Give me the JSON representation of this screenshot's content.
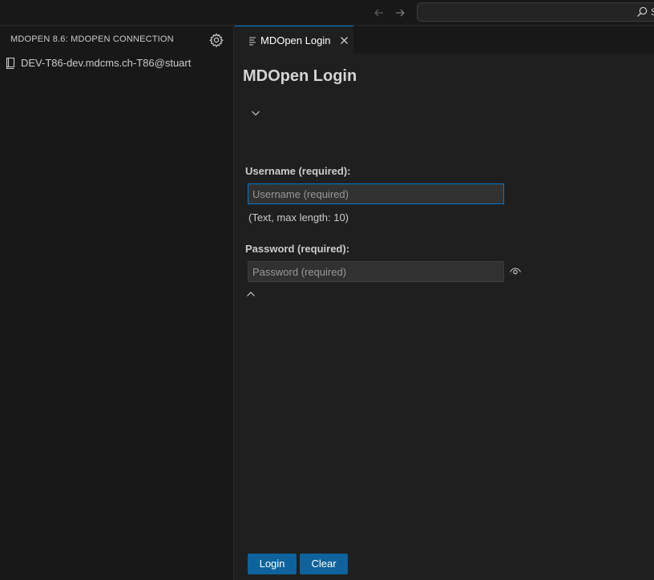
{
  "titlebar": {
    "back_icon": "arrow-left-icon",
    "forward_icon": "arrow-right-icon",
    "command_center": {
      "icon": "search-icon",
      "text": "S"
    }
  },
  "sidebar": {
    "title": "MDOPEN 8.6: MDOPEN CONNECTION",
    "settings_icon": "gear-icon",
    "items": [
      {
        "icon": "book-icon",
        "label": "DEV-T86-dev.mdcms.ch-T86@stuart"
      }
    ]
  },
  "tabs": [
    {
      "icon": "preview-icon",
      "label": "MDOpen Login",
      "close_icon": "close-icon",
      "active": true
    }
  ],
  "form": {
    "title": "MDOpen Login",
    "username": {
      "label": "Username (required):",
      "placeholder": "Username (required)",
      "value": "",
      "hint": "(Text, max length: 10)"
    },
    "password": {
      "label": "Password (required):",
      "placeholder": "Password (required)",
      "value": "",
      "toggle_icon": "eye-icon"
    },
    "login_label": "Login",
    "clear_label": "Clear"
  },
  "colors": {
    "accent": "#0078d4",
    "button": "#0e639c",
    "editor_bg": "#1f1f1f",
    "sidebar_bg": "#181818"
  }
}
